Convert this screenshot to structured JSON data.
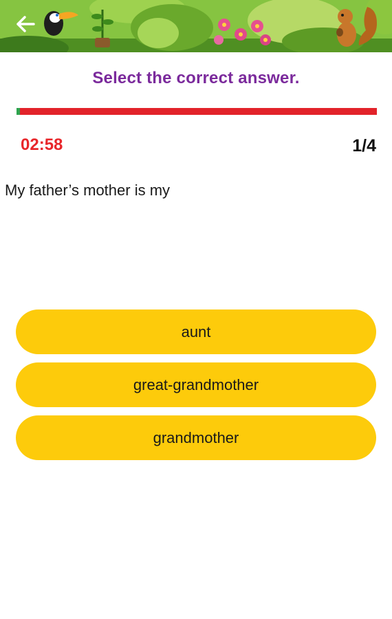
{
  "header": {
    "back_icon": "arrow-left-icon",
    "decorations": [
      "toucan",
      "sapling",
      "jungle-leaves",
      "pink-flowers",
      "squirrel"
    ]
  },
  "instruction": "Select the correct answer.",
  "progress": {
    "fraction": 0.01,
    "track_color": "#e2232a",
    "fill_color": "#2ea44f"
  },
  "timer": "02:58",
  "question_counter": "1/4",
  "question": "My father’s mother is my",
  "answers": [
    {
      "label": "aunt"
    },
    {
      "label": "great-grandmother"
    },
    {
      "label": "grandmother"
    }
  ],
  "colors": {
    "title": "#7b2a9c",
    "timer": "#e8262a",
    "answer_bg": "#fdcb0b"
  }
}
